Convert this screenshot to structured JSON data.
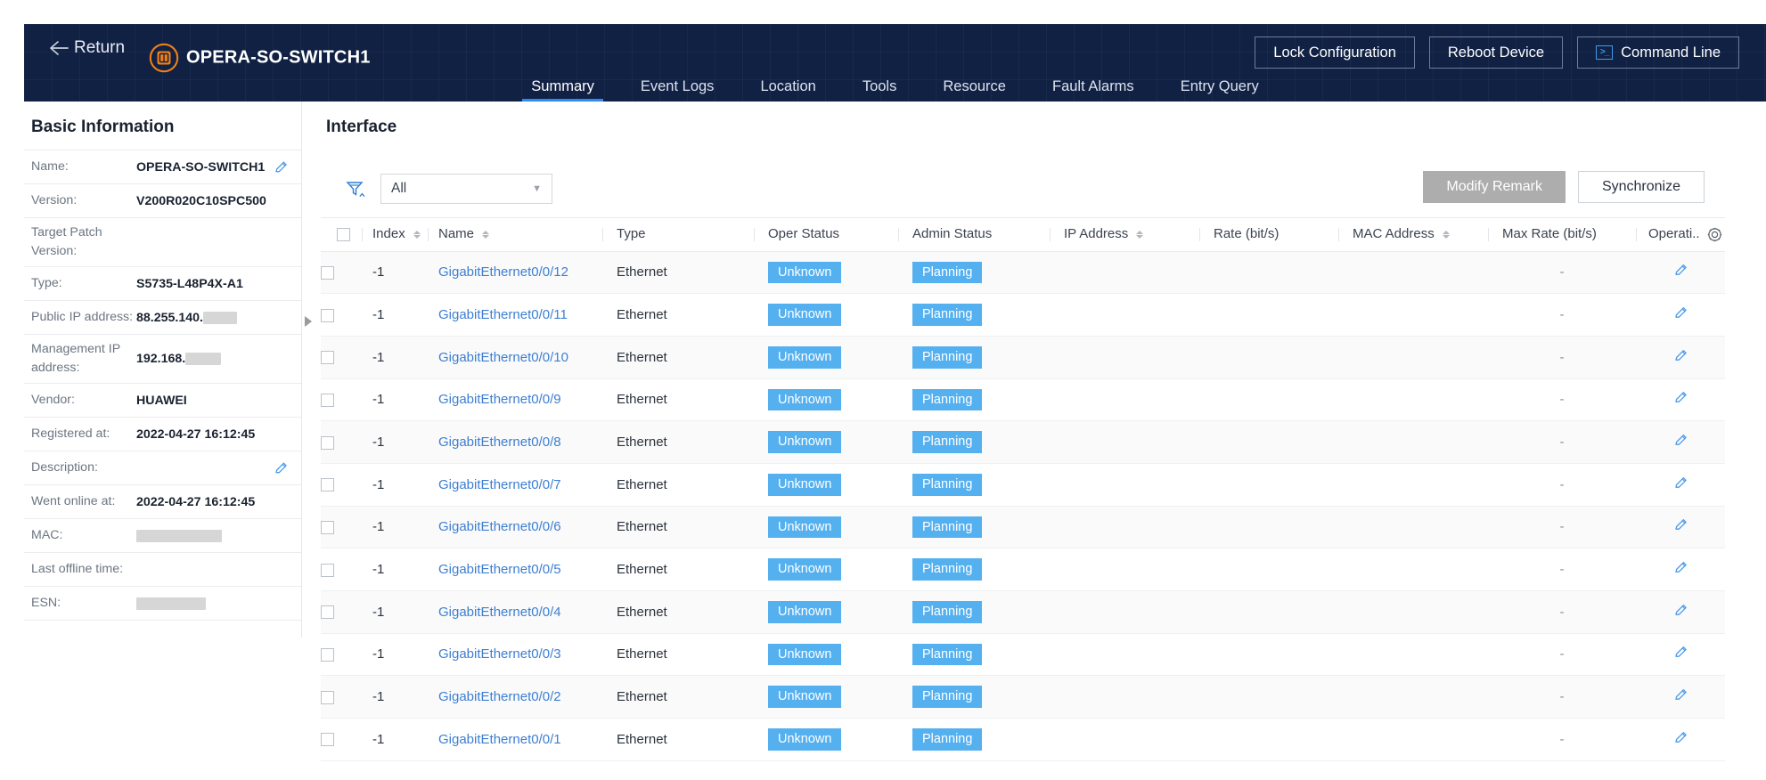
{
  "header": {
    "back_label": "Return",
    "device_name": "OPERA-SO-SWITCH1",
    "buttons": [
      {
        "label": "Lock Configuration",
        "icon": ""
      },
      {
        "label": "Reboot Device",
        "icon": ""
      },
      {
        "label": "Command Line",
        "icon": "command-line-icon"
      }
    ]
  },
  "nav": {
    "tabs": [
      {
        "label": "Summary",
        "active": true
      },
      {
        "label": "Event Logs",
        "active": false
      },
      {
        "label": "Location",
        "active": false
      },
      {
        "label": "Tools",
        "active": false
      },
      {
        "label": "Resource",
        "active": false
      },
      {
        "label": "Fault Alarms",
        "active": false
      },
      {
        "label": "Entry Query",
        "active": false
      }
    ]
  },
  "sidebar": {
    "title": "Basic Information",
    "rows": [
      {
        "label": "Name:",
        "value": "OPERA-SO-SWITCH1",
        "edit": true
      },
      {
        "label": "Version:",
        "value": "V200R020C10SPC500",
        "edit": false
      },
      {
        "label": "Target Patch Version:",
        "value": "",
        "edit": false
      },
      {
        "label": "Type:",
        "value": "S5735-L48P4X-A1",
        "edit": false
      },
      {
        "label": "Public IP address:",
        "value": "88.255.140.",
        "redacted": "w1",
        "edit": false
      },
      {
        "label": "Management IP address:",
        "value": "192.168.",
        "redacted": "w2",
        "edit": false
      },
      {
        "label": "Vendor:",
        "value": "HUAWEI",
        "edit": false
      },
      {
        "label": "Registered at:",
        "value": "2022-04-27 16:12:45",
        "edit": false
      },
      {
        "label": "Description:",
        "value": "",
        "edit": true
      },
      {
        "label": "Went online at:",
        "value": "2022-04-27 16:12:45",
        "edit": false
      },
      {
        "label": "MAC:",
        "value": "",
        "redacted": "w3",
        "edit": false
      },
      {
        "label": "Last offline time:",
        "value": "",
        "edit": false
      },
      {
        "label": "ESN:",
        "value": "",
        "redacted": "w4",
        "edit": false
      }
    ]
  },
  "main": {
    "title": "Interface",
    "toolbar": {
      "filter_icon": "filter-icon",
      "select_value": "All",
      "modify_remark_label": "Modify Remark",
      "synchronize_label": "Synchronize"
    },
    "table": {
      "columns": [
        {
          "key": "checkbox",
          "label": "",
          "sortable": false
        },
        {
          "key": "index",
          "label": "Index",
          "sortable": true
        },
        {
          "key": "name",
          "label": "Name",
          "sortable": true
        },
        {
          "key": "type",
          "label": "Type",
          "sortable": false
        },
        {
          "key": "oper_status",
          "label": "Oper Status",
          "sortable": false
        },
        {
          "key": "admin_status",
          "label": "Admin Status",
          "sortable": false
        },
        {
          "key": "ip_address",
          "label": "IP Address",
          "sortable": true
        },
        {
          "key": "rate",
          "label": "Rate (bit/s)",
          "sortable": false
        },
        {
          "key": "mac_address",
          "label": "MAC Address",
          "sortable": true
        },
        {
          "key": "max_rate",
          "label": "Max Rate (bit/s)",
          "sortable": false
        },
        {
          "key": "operation",
          "label": "Operati..",
          "sortable": false,
          "icon": "gear-icon"
        }
      ],
      "rows": [
        {
          "index": "-1",
          "name": "GigabitEthernet0/0/12",
          "type": "Ethernet",
          "oper_status": "Unknown",
          "admin_status": "Planning",
          "ip_address": "",
          "rate": "",
          "mac_address": "",
          "max_rate": "-"
        },
        {
          "index": "-1",
          "name": "GigabitEthernet0/0/11",
          "type": "Ethernet",
          "oper_status": "Unknown",
          "admin_status": "Planning",
          "ip_address": "",
          "rate": "",
          "mac_address": "",
          "max_rate": "-"
        },
        {
          "index": "-1",
          "name": "GigabitEthernet0/0/10",
          "type": "Ethernet",
          "oper_status": "Unknown",
          "admin_status": "Planning",
          "ip_address": "",
          "rate": "",
          "mac_address": "",
          "max_rate": "-"
        },
        {
          "index": "-1",
          "name": "GigabitEthernet0/0/9",
          "type": "Ethernet",
          "oper_status": "Unknown",
          "admin_status": "Planning",
          "ip_address": "",
          "rate": "",
          "mac_address": "",
          "max_rate": "-"
        },
        {
          "index": "-1",
          "name": "GigabitEthernet0/0/8",
          "type": "Ethernet",
          "oper_status": "Unknown",
          "admin_status": "Planning",
          "ip_address": "",
          "rate": "",
          "mac_address": "",
          "max_rate": "-"
        },
        {
          "index": "-1",
          "name": "GigabitEthernet0/0/7",
          "type": "Ethernet",
          "oper_status": "Unknown",
          "admin_status": "Planning",
          "ip_address": "",
          "rate": "",
          "mac_address": "",
          "max_rate": "-"
        },
        {
          "index": "-1",
          "name": "GigabitEthernet0/0/6",
          "type": "Ethernet",
          "oper_status": "Unknown",
          "admin_status": "Planning",
          "ip_address": "",
          "rate": "",
          "mac_address": "",
          "max_rate": "-"
        },
        {
          "index": "-1",
          "name": "GigabitEthernet0/0/5",
          "type": "Ethernet",
          "oper_status": "Unknown",
          "admin_status": "Planning",
          "ip_address": "",
          "rate": "",
          "mac_address": "",
          "max_rate": "-"
        },
        {
          "index": "-1",
          "name": "GigabitEthernet0/0/4",
          "type": "Ethernet",
          "oper_status": "Unknown",
          "admin_status": "Planning",
          "ip_address": "",
          "rate": "",
          "mac_address": "",
          "max_rate": "-"
        },
        {
          "index": "-1",
          "name": "GigabitEthernet0/0/3",
          "type": "Ethernet",
          "oper_status": "Unknown",
          "admin_status": "Planning",
          "ip_address": "",
          "rate": "",
          "mac_address": "",
          "max_rate": "-"
        },
        {
          "index": "-1",
          "name": "GigabitEthernet0/0/2",
          "type": "Ethernet",
          "oper_status": "Unknown",
          "admin_status": "Planning",
          "ip_address": "",
          "rate": "",
          "mac_address": "",
          "max_rate": "-"
        },
        {
          "index": "-1",
          "name": "GigabitEthernet0/0/1",
          "type": "Ethernet",
          "oper_status": "Unknown",
          "admin_status": "Planning",
          "ip_address": "",
          "rate": "",
          "mac_address": "",
          "max_rate": "-"
        }
      ]
    }
  },
  "colors": {
    "header_bg": "#112144",
    "accent_blue": "#2f8bf0",
    "badge_blue": "#55b0ef",
    "link_blue": "#3d7fd1",
    "brand_orange": "#f08016",
    "disabled_gray": "#adadad"
  }
}
